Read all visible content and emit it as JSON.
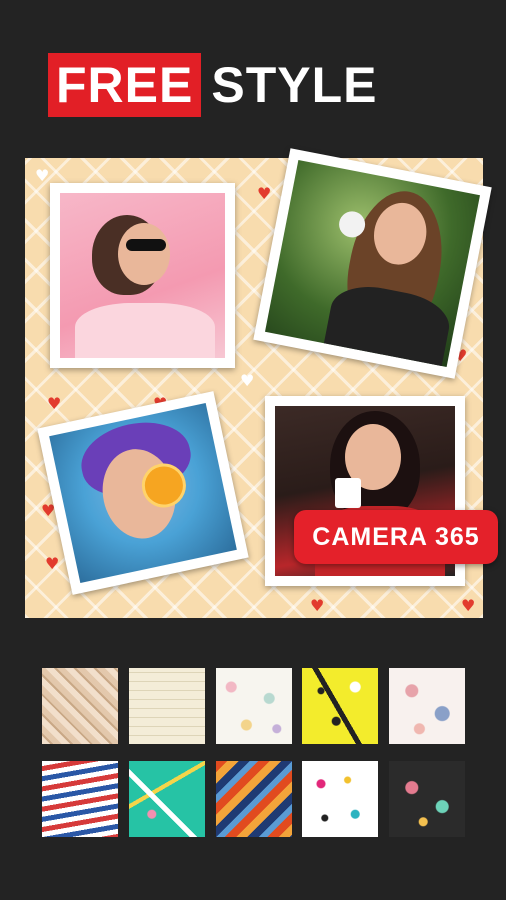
{
  "header": {
    "title_highlight": "FREE",
    "title_rest": "STYLE"
  },
  "collage": {
    "badge_label": "CAMERA 365",
    "photos": [
      {
        "name": "photo-woman-sunglasses"
      },
      {
        "name": "photo-woman-dandelion"
      },
      {
        "name": "photo-woman-orange"
      },
      {
        "name": "photo-woman-coffee"
      }
    ]
  },
  "backgrounds": {
    "row1": [
      "weave-pattern",
      "lined-paper-pattern",
      "doodle-pattern",
      "yellow-memphis-pattern",
      "floral-bird-pattern"
    ],
    "row2": [
      "chevron-stripes-pattern",
      "teal-confetti-pattern",
      "aztec-pattern",
      "memphis-shapes-pattern",
      "dark-icons-pattern"
    ]
  },
  "colors": {
    "accent": "#e21f26",
    "background": "#232323",
    "collage_bg": "#f8dcae"
  }
}
